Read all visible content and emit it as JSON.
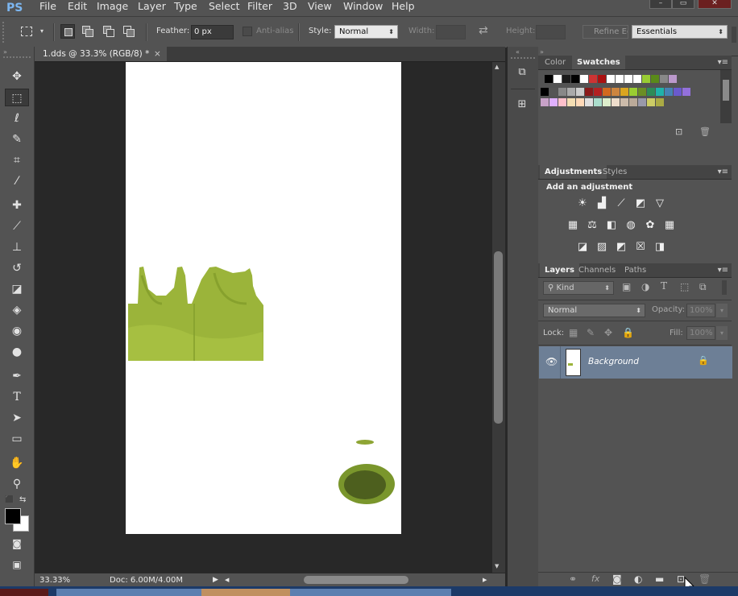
{
  "app": {
    "logo": "PS"
  },
  "menu": [
    "File",
    "Edit",
    "Image",
    "Layer",
    "Type",
    "Select",
    "Filter",
    "3D",
    "View",
    "Window",
    "Help"
  ],
  "window_controls": [
    "–",
    "▭",
    "✕"
  ],
  "options": {
    "feather_label": "Feather:",
    "feather_value": "0 px",
    "antialias_label": "Anti-alias",
    "style_label": "Style:",
    "style_value": "Normal",
    "width_label": "Width:",
    "height_label": "Height:",
    "refine_label": "Refine Edge...",
    "workspace_value": "Essentials"
  },
  "document": {
    "tab_title": "1.dds @ 33.3% (RGB/8) *",
    "tab_close": "×",
    "zoom": "33.33%",
    "doc_info": "Doc: 6.00M/4.00M"
  },
  "toolbar": {
    "tools": [
      {
        "name": "move-tool",
        "glyph": "✥"
      },
      {
        "name": "rect-marquee-tool",
        "glyph": "⬚"
      },
      {
        "name": "lasso-tool",
        "glyph": "ℓ"
      },
      {
        "name": "quick-select-tool",
        "glyph": "✎"
      },
      {
        "name": "crop-tool",
        "glyph": "⌗"
      },
      {
        "name": "eyedropper-tool",
        "glyph": "⁄"
      },
      {
        "name": "healing-brush-tool",
        "glyph": "✚"
      },
      {
        "name": "brush-tool",
        "glyph": "⟋"
      },
      {
        "name": "clone-stamp-tool",
        "glyph": "⊥"
      },
      {
        "name": "history-brush-tool",
        "glyph": "↺"
      },
      {
        "name": "eraser-tool",
        "glyph": "◪"
      },
      {
        "name": "paint-bucket-tool",
        "glyph": "◈"
      },
      {
        "name": "blur-tool",
        "glyph": "◉"
      },
      {
        "name": "dodge-tool",
        "glyph": "●"
      },
      {
        "name": "pen-tool",
        "glyph": "✒"
      },
      {
        "name": "type-tool",
        "glyph": "T"
      },
      {
        "name": "path-select-tool",
        "glyph": "➤"
      },
      {
        "name": "rectangle-tool",
        "glyph": "▭"
      },
      {
        "name": "hand-tool",
        "glyph": "✋"
      },
      {
        "name": "zoom-tool",
        "glyph": "⚲"
      }
    ],
    "default_colors_icon": "⬛",
    "swap_colors_icon": "⇆",
    "quick_mask_icon": "◙",
    "screen_mode_icon": "▣"
  },
  "panels": {
    "color_tab": "Color",
    "swatches_tab": "Swatches",
    "adjustments_tab": "Adjustments",
    "styles_tab": "Styles",
    "add_adjustment": "Add an adjustment",
    "layers_tab": "Layers",
    "channels_tab": "Channels",
    "paths_tab": "Paths",
    "kind_label": "Kind",
    "blend_mode": "Normal",
    "opacity_label": "Opacity:",
    "opacity_value": "100%",
    "lock_label": "Lock:",
    "fill_label": "Fill:",
    "fill_value": "100%",
    "layer_name": "Background",
    "panel_menu": "▾≡"
  },
  "swatches": {
    "row1": [
      "#000000",
      "#ffffff",
      "#1a1a1a",
      "#000000",
      "#ffffff",
      "#cc3333",
      "#aa1111",
      "#ffffff",
      "#ffffff",
      "#ffffff",
      "#ffffff",
      "#99cc33",
      "#5a8a1a",
      "#888888",
      "#bb99cc"
    ],
    "row2": [
      "#000000",
      "#555555",
      "#888888",
      "#aaaaaa",
      "#cccccc",
      "#8b1a1a",
      "#b22222",
      "#d2691e",
      "#cd853f",
      "#daa520",
      "#9acd32",
      "#6b8e23",
      "#2e8b57",
      "#20b2aa",
      "#4682b4",
      "#6a5acd",
      "#9370db"
    ],
    "row3": [
      "#c8a2c8",
      "#e0b0ff",
      "#ffc0cb",
      "#f5deb3",
      "#ffdab9",
      "#e0e0e0",
      "#aaddcc",
      "#ddeecc",
      "#eeddcc",
      "#ccbbaa",
      "#bbaa99",
      "#9999aa",
      "#cccc66",
      "#aaaa44"
    ]
  }
}
